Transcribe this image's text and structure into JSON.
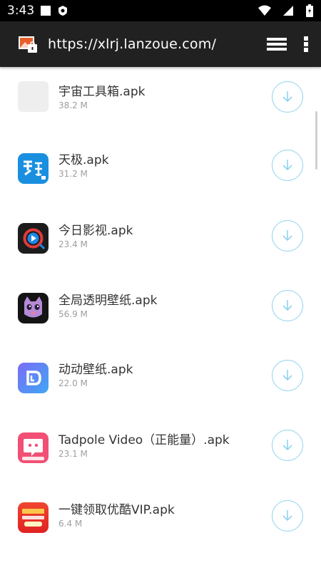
{
  "status_bar": {
    "time": "3:43",
    "icons": [
      "notification-square-icon",
      "shield-app-icon",
      "wifi-icon",
      "signal-icon",
      "battery-icon"
    ]
  },
  "toolbar": {
    "url": "https://xlrj.lanzoue.com/",
    "site_icon": "site-icon",
    "tabs_icon": "tabs-stack-icon",
    "menu_icon": "more-vert-icon"
  },
  "files": [
    {
      "name": "宇宙工具箱.apk",
      "size": "38.2 M",
      "icon": "placeholder-app-icon"
    },
    {
      "name": "天极.apk",
      "size": "31.2 M",
      "icon": "tianji-app-icon"
    },
    {
      "name": "今日影视.apk",
      "size": "23.4 M",
      "icon": "jinri-yingshi-app-icon"
    },
    {
      "name": "全局透明壁纸.apk",
      "size": "56.9 M",
      "icon": "cat-wallpaper-app-icon"
    },
    {
      "name": "动动壁纸.apk",
      "size": "22.0 M",
      "icon": "dongdong-app-icon"
    },
    {
      "name": "Tadpole Video（正能量）.apk",
      "size": "23.1 M",
      "icon": "tadpole-app-icon"
    },
    {
      "name": "一键领取优酷VIP.apk",
      "size": "6.4 M",
      "icon": "youku-vip-app-icon"
    }
  ],
  "colors": {
    "toolbar_bg": "#212121",
    "download_accent": "#8fd3ef",
    "size_text": "#9e9e9e"
  }
}
